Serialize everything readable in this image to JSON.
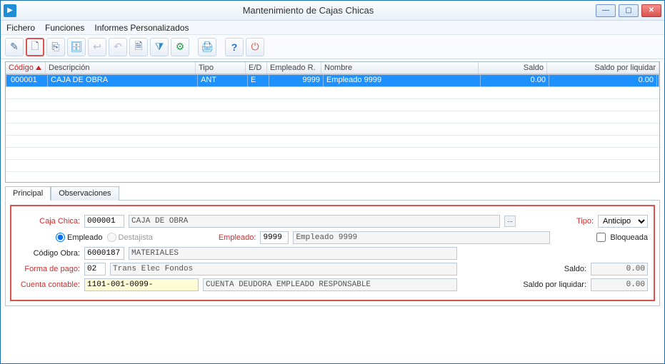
{
  "window": {
    "title": "Mantenimiento de Cajas Chicas"
  },
  "menu": {
    "fichero": "Fichero",
    "funciones": "Funciones",
    "informes": "Informes Personalizados"
  },
  "toolbar": {
    "edit": "✎",
    "new": "🗋",
    "copy": "⎘",
    "arch": "🗄",
    "undo1": "↩",
    "undo2": "↶",
    "page": "🗎",
    "filter": "⧩",
    "cfg": "⚙",
    "print": "🖨",
    "help": "?",
    "power": "⏻"
  },
  "grid": {
    "headers": {
      "codigo": "Código",
      "descripcion": "Descripción",
      "tipo": "Tipo",
      "ed": "E/D",
      "empleadoR": "Empleado R.",
      "nombre": "Nombre",
      "saldo": "Saldo",
      "saldoLiq": "Saldo por liquidar"
    },
    "rows": [
      {
        "codigo": "000001",
        "descripcion": "CAJA DE OBRA",
        "tipo": "ANT",
        "ed": "E",
        "empleadoR": "9999",
        "nombre": "Empleado 9999",
        "saldo": "0.00",
        "saldoLiq": "0.00"
      }
    ]
  },
  "tabs": {
    "principal": "Principal",
    "observaciones": "Observaciones"
  },
  "form": {
    "labels": {
      "cajaChica": "Caja Chica:",
      "tipo": "Tipo:",
      "empleadoOpt": "Empleado",
      "destajistaOpt": "Destajista",
      "empleado": "Empleado:",
      "bloqueada": "Bloqueada",
      "codigoObra": "Código Obra:",
      "formaPago": "Forma de pago:",
      "cuentaContable": "Cuenta contable:",
      "saldo": "Saldo:",
      "saldoLiq": "Saldo por liquidar:"
    },
    "values": {
      "cajaChicaCode": "000001",
      "cajaChicaName": "CAJA DE OBRA",
      "tipo": "Anticipo",
      "empleadoCode": "9999",
      "empleadoName": "Empleado 9999",
      "obraCode": "6000187",
      "obraName": "MATERIALES",
      "formaPagoCode": "02",
      "formaPagoName": "Trans Elec Fondos",
      "cuentaCode": "1101-001-0099-",
      "cuentaName": "CUENTA DEUDORA EMPLEADO RESPONSABLE",
      "saldo": "0.00",
      "saldoLiq": "0.00"
    }
  }
}
